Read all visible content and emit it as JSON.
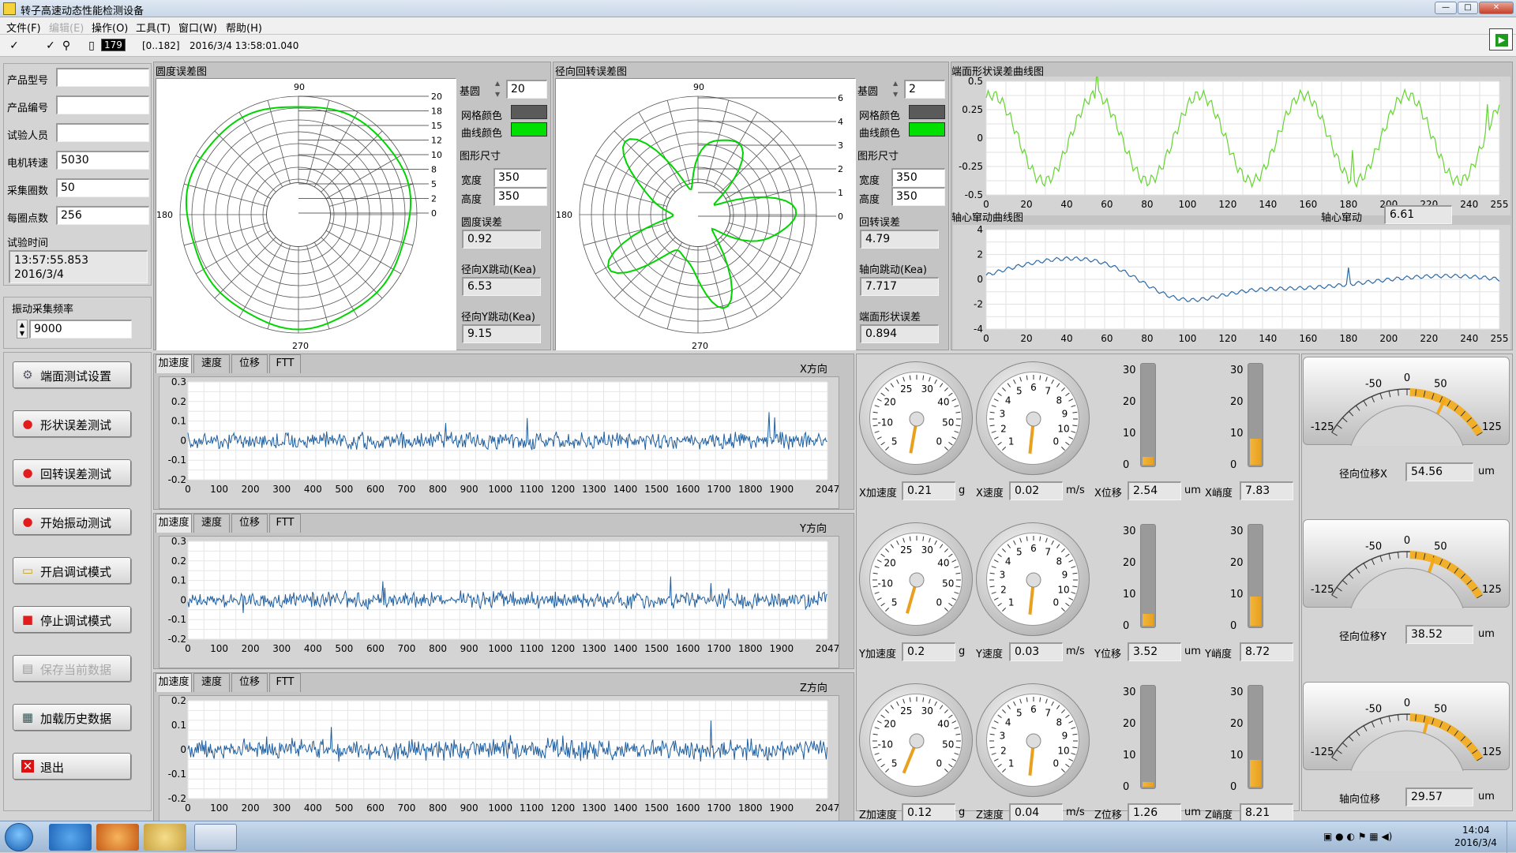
{
  "window": {
    "title": "转子高速动态性能检测设备"
  },
  "menus": [
    "文件(F)",
    "编辑(E)",
    "操作(O)",
    "工具(T)",
    "窗口(W)",
    "帮助(H)"
  ],
  "toolbar": {
    "index": "179",
    "range": "[0..182]",
    "timestamp": "2016/3/4  13:58:01.040"
  },
  "info": {
    "product_model_label": "产品型号",
    "product_model": "",
    "product_no_label": "产品编号",
    "product_no": "",
    "tester_label": "试验人员",
    "tester": "",
    "motor_speed_label": "电机转速",
    "motor_speed": "5030",
    "circles_label": "采集圈数",
    "circles": "50",
    "points_label": "每圈点数",
    "points": "256",
    "test_time_label": "试验时间",
    "test_time": "13:57:55.853",
    "test_date": "2016/3/4"
  },
  "vib_freq": {
    "label": "振动采集频率",
    "value": "9000"
  },
  "buttons": [
    {
      "label": "端面测试设置",
      "icon": "gear-icon",
      "enabled": true
    },
    {
      "label": "形状误差测试",
      "icon": "red-dot-icon",
      "enabled": true
    },
    {
      "label": "回转误差测试",
      "icon": "red-dot-icon",
      "enabled": true
    },
    {
      "label": "开始振动测试",
      "icon": "red-dot-icon",
      "enabled": true
    },
    {
      "label": "开启调试模式",
      "icon": "page-icon",
      "enabled": true
    },
    {
      "label": "停止调试模式",
      "icon": "red-square-icon",
      "enabled": true
    },
    {
      "label": "保存当前数据",
      "icon": "save-icon",
      "enabled": false
    },
    {
      "label": "加载历史数据",
      "icon": "folder-icon",
      "enabled": true
    },
    {
      "label": "退出",
      "icon": "exit-icon",
      "enabled": true
    }
  ],
  "roundness": {
    "title": "圆度误差图",
    "angles": {
      "top": "90",
      "left": "180",
      "bottom": "270"
    },
    "radial_ticks": [
      "20",
      "18",
      "15",
      "12",
      "10",
      "8",
      "5",
      "2",
      "0"
    ],
    "base_label": "基圆",
    "base": "20",
    "grid_color_label": "网格颜色",
    "curve_color_label": "曲线颜色",
    "grid_color": "#5a5a5a",
    "curve_color": "#00e000",
    "size_label": "图形尺寸",
    "width_label": "宽度",
    "width": "350",
    "height_label": "高度",
    "height": "350",
    "err_label": "圆度误差",
    "err": "0.92",
    "rx_label": "径向X跳动(Kea)",
    "rx": "6.53",
    "ry_label": "径向Y跳动(Kea)",
    "ry": "9.15"
  },
  "rotation": {
    "title": "径向回转误差图",
    "angles": {
      "top": "90",
      "left": "180",
      "bottom": "270"
    },
    "radial_ticks": [
      "6",
      "4",
      "3",
      "2",
      "1",
      "0"
    ],
    "base_label": "基圆",
    "base": "2",
    "grid_color_label": "网格颜色",
    "curve_color_label": "曲线颜色",
    "size_label": "图形尺寸",
    "width_label": "宽度",
    "width": "350",
    "height_label": "高度",
    "height": "350",
    "err_label": "回转误差",
    "err": "4.79",
    "axial_label": "轴向跳动(Kea)",
    "axial": "7.717",
    "face_label": "端面形状误差",
    "face": "0.894"
  },
  "face_curve": {
    "title": "端面形状误差曲线图",
    "yticks": [
      "0.5",
      "0.25",
      "0",
      "-0.25",
      "-0.5"
    ],
    "xticks": [
      "0",
      "20",
      "40",
      "60",
      "80",
      "100",
      "120",
      "140",
      "160",
      "180",
      "200",
      "220",
      "240",
      "255"
    ]
  },
  "axial_curve": {
    "title": "轴心窜动曲线图",
    "value_label": "轴心窜动",
    "value": "6.61",
    "yticks": [
      "4",
      "2",
      "0",
      "-2",
      "-4"
    ],
    "xticks": [
      "0",
      "20",
      "40",
      "60",
      "80",
      "100",
      "120",
      "140",
      "160",
      "180",
      "200",
      "220",
      "240",
      "255"
    ]
  },
  "vib_tabs": [
    "加速度",
    "速度",
    "位移",
    "FTT"
  ],
  "vib": [
    {
      "dir": "X方向",
      "yticks": [
        "0.3",
        "0.2",
        "0.1",
        "0",
        "-0.1",
        "-0.2"
      ]
    },
    {
      "dir": "Y方向",
      "yticks": [
        "0.3",
        "0.2",
        "0.1",
        "0",
        "-0.1",
        "-0.2"
      ]
    },
    {
      "dir": "Z方向",
      "yticks": [
        "0.2",
        "0.1",
        "0",
        "-0.1",
        "-0.2"
      ]
    }
  ],
  "vib_xticks": [
    "0",
    "100",
    "200",
    "300",
    "400",
    "500",
    "600",
    "700",
    "800",
    "900",
    "1000",
    "1100",
    "1200",
    "1300",
    "1400",
    "1500",
    "1600",
    "1700",
    "1800",
    "1900",
    "2047"
  ],
  "gauges": {
    "acc_ticks": [
      "20",
      "25",
      "30",
      "-10",
      "40",
      "5",
      "0",
      "50"
    ],
    "vel_ticks": [
      "5",
      "6",
      "4",
      "7",
      "3",
      "8",
      "9",
      "2",
      "1",
      "0",
      "10"
    ],
    "tank_ticks": [
      "30",
      "20",
      "10",
      "0"
    ],
    "rows": [
      {
        "acc_label": "X加速度",
        "acc": "0.21",
        "acc_unit": "g",
        "vel_label": "X速度",
        "vel": "0.02",
        "vel_unit": "m/s",
        "disp_label": "X位移",
        "disp": "2.54",
        "disp_unit": "um",
        "kurt_label": "X峭度",
        "kurt": "7.83",
        "disp_level": 0.08,
        "kurt_level": 0.26
      },
      {
        "acc_label": "Y加速度",
        "acc": "0.2",
        "acc_unit": "g",
        "vel_label": "Y速度",
        "vel": "0.03",
        "vel_unit": "m/s",
        "disp_label": "Y位移",
        "disp": "3.52",
        "disp_unit": "um",
        "kurt_label": "Y峭度",
        "kurt": "8.72",
        "disp_level": 0.12,
        "kurt_level": 0.29
      },
      {
        "acc_label": "Z加速度",
        "acc": "0.12",
        "acc_unit": "g",
        "vel_label": "Z速度",
        "vel": "0.04",
        "vel_unit": "m/s",
        "disp_label": "Z位移",
        "disp": "1.26",
        "disp_unit": "um",
        "kurt_label": "Z峭度",
        "kurt": "8.21",
        "disp_level": 0.05,
        "kurt_level": 0.27
      }
    ]
  },
  "meters": {
    "ticks": [
      "-125",
      "-50",
      "0",
      "50",
      "125"
    ],
    "rows": [
      {
        "label": "径向位移X",
        "value": "54.56",
        "unit": "um"
      },
      {
        "label": "径向位移Y",
        "value": "38.52",
        "unit": "um"
      },
      {
        "label": "轴向位移",
        "value": "29.57",
        "unit": "um"
      }
    ]
  },
  "taskbar": {
    "time": "14:04",
    "date": "2016/3/4"
  }
}
